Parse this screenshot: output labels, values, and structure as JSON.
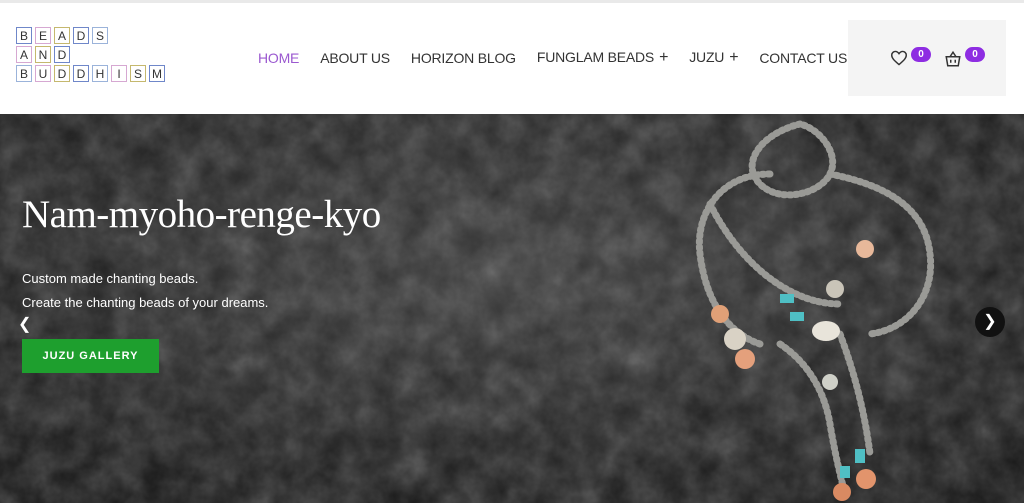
{
  "logo": {
    "rows": [
      [
        "B",
        "E",
        "A",
        "D",
        "S"
      ],
      [
        "A",
        "N",
        "D"
      ],
      [
        "B",
        "U",
        "D",
        "D",
        "H",
        "I",
        "S",
        "M"
      ]
    ],
    "cell_colors": [
      "#6f87c9",
      "#d6a8d2",
      "#c5b86e",
      "#6f87c9",
      "#9bb3da",
      "#d6a8d2",
      "#c5b86e",
      "#6f87c9",
      "#9bb3da",
      "#d6a8d2",
      "#c5b86e",
      "#6f87c9",
      "#9bb3da",
      "#d6a8d2",
      "#c5b86e",
      "#6f87c9"
    ]
  },
  "nav": {
    "items": [
      "HOME",
      "ABOUT US",
      "HORIZON BLOG",
      "FUNGLAM BEADS",
      "JUZU",
      "CONTACT US"
    ],
    "plus": "+"
  },
  "header_right": {
    "wishlist_count": "0",
    "cart_count": "0"
  },
  "hero": {
    "title": "Nam-myoho-renge-kyo",
    "subtitle1": "Custom made chanting beads.",
    "subtitle2": "Create the chanting beads of your dreams.",
    "cta_label": "JUZU GALLERY",
    "prev_label": "❮",
    "next_label": "❯"
  },
  "colors": {
    "accent": "#8e2de2",
    "nav_active": "#9b59d0",
    "cta": "#1e9f2e"
  }
}
